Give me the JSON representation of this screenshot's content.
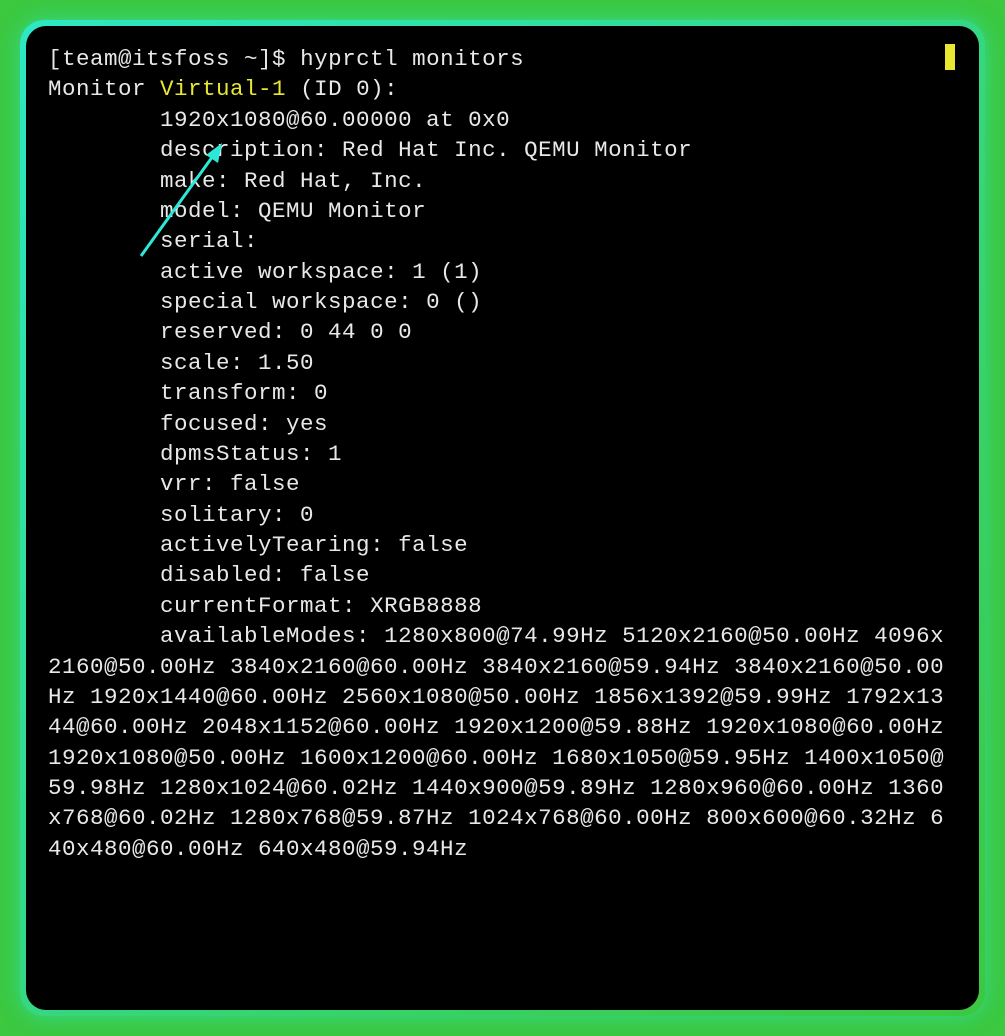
{
  "prompt": {
    "user_host": "[team@itsfoss ~]$",
    "command": "hyprctl monitors"
  },
  "monitor": {
    "label_prefix": "Monitor ",
    "name": "Virtual-1",
    "id_suffix": " (ID 0):",
    "resolution": "1920x1080@60.00000 at 0x0",
    "description": "description: Red Hat Inc. QEMU Monitor",
    "make": "make: Red Hat, Inc.",
    "model": "model: QEMU Monitor",
    "serial": "serial:",
    "active_workspace": "active workspace: 1 (1)",
    "special_workspace": "special workspace: 0 ()",
    "reserved": "reserved: 0 44 0 0",
    "scale": "scale: 1.50",
    "transform": "transform: 0",
    "focused": "focused: yes",
    "dpmsStatus": "dpmsStatus: 1",
    "vrr": "vrr: false",
    "solitary": "solitary: 0",
    "activelyTearing": "activelyTearing: false",
    "disabled": "disabled: false",
    "currentFormat": "currentFormat: XRGB8888",
    "availableModes_label": "availableModes: ",
    "availableModes": "1280x800@74.99Hz 5120x2160@50.00Hz 4096x2160@50.00Hz 3840x2160@60.00Hz 3840x2160@59.94Hz 3840x2160@50.00Hz 1920x1440@60.00Hz 2560x1080@50.00Hz 1856x1392@59.99Hz 1792x1344@60.00Hz 2048x1152@60.00Hz 1920x1200@59.88Hz 1920x1080@60.00Hz 1920x1080@50.00Hz 1600x1200@60.00Hz 1680x1050@59.95Hz 1400x1050@59.98Hz 1280x1024@60.02Hz 1440x900@59.89Hz 1280x960@60.00Hz 1360x768@60.02Hz 1280x768@59.87Hz 1024x768@60.00Hz 800x600@60.32Hz 640x480@60.00Hz 640x480@59.94Hz"
  },
  "indent": "        "
}
